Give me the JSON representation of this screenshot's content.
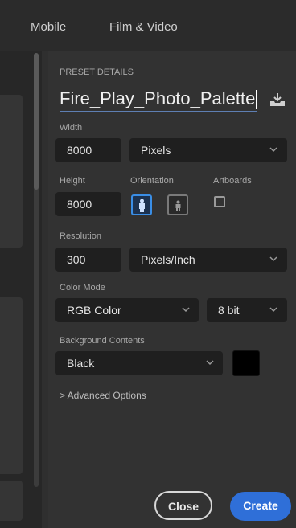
{
  "tabs": [
    "Mobile",
    "Film & Video"
  ],
  "preset": {
    "section_label": "PRESET DETAILS",
    "name": "Fire_Play_Photo_Palette"
  },
  "width": {
    "label": "Width",
    "value": "8000",
    "unit": "Pixels"
  },
  "height": {
    "label": "Height",
    "value": "8000"
  },
  "orientation": {
    "label": "Orientation",
    "selected": "portrait"
  },
  "artboards": {
    "label": "Artboards",
    "checked": false
  },
  "resolution": {
    "label": "Resolution",
    "value": "300",
    "unit": "Pixels/Inch"
  },
  "color_mode": {
    "label": "Color Mode",
    "mode": "RGB Color",
    "depth": "8 bit"
  },
  "background": {
    "label": "Background Contents",
    "value": "Black",
    "swatch_color": "#000000"
  },
  "advanced": {
    "label": "> Advanced Options"
  },
  "actions": {
    "close": "Close",
    "create": "Create"
  },
  "colors": {
    "accent": "#2f6fd8",
    "panel": "#323232",
    "field": "#1f1f1f"
  }
}
